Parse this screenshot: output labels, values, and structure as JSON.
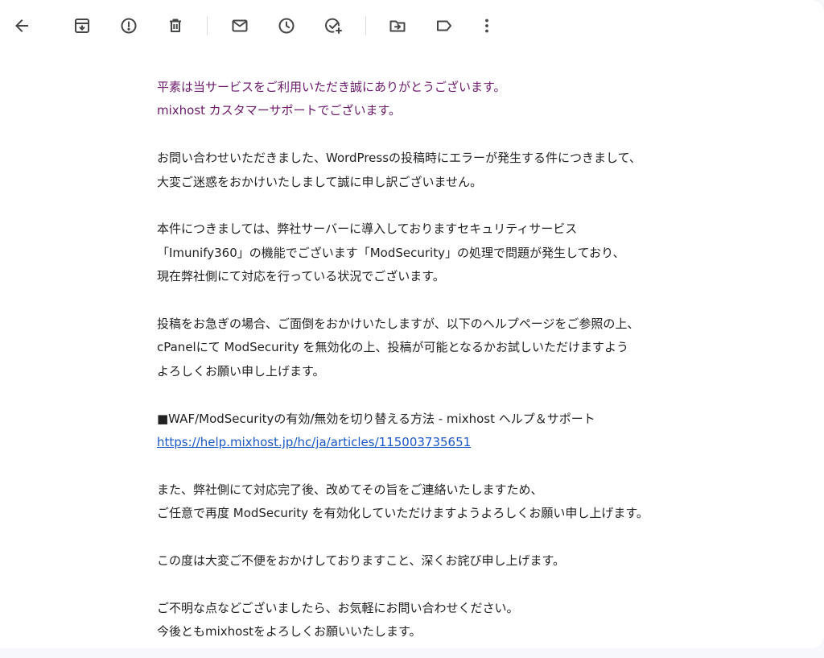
{
  "toolbar": {
    "icons": [
      "back-arrow-icon",
      "archive-icon",
      "report-spam-icon",
      "delete-icon",
      "mark-unread-icon",
      "snooze-icon",
      "add-to-tasks-icon",
      "move-to-icon",
      "label-icon",
      "more-options-icon"
    ]
  },
  "email": {
    "greeting": [
      "平素は当サービスをご利用いただき誠にありがとうございます。",
      "mixhost カスタマーサポートでございます。"
    ],
    "paragraph1": [
      "お問い合わせいただきました、WordPressの投稿時にエラーが発生する件につきまして、",
      "大変ご迷惑をおかけいたしまして誠に申し訳ございません。"
    ],
    "paragraph2": [
      "本件につきましては、弊社サーバーに導入しておりますセキュリティサービス",
      "「Imunify360」の機能でございます「ModSecurity」の処理で問題が発生しており、",
      "現在弊社側にて対応を行っている状況でございます。"
    ],
    "paragraph3": [
      "投稿をお急ぎの場合、ご面倒をおかけいたしますが、以下のヘルプページをご参照の上、",
      "cPanelにて ModSecurity を無効化の上、投稿が可能となるかお試しいただけますよう",
      "よろしくお願い申し上げます。"
    ],
    "help_title": "■WAF/ModSecurityの有効/無効を切り替える方法 - mixhost ヘルプ＆サポート",
    "help_link": "https://help.mixhost.jp/hc/ja/articles/115003735651",
    "paragraph4": [
      "また、弊社側にて対応完了後、改めてその旨をご連絡いたしますため、",
      "ご任意で再度 ModSecurity を有効化していただけますようよろしくお願い申し上げます。"
    ],
    "paragraph5": "この度は大変ご不便をおかけしておりますこと、深くお詫び申し上げます。",
    "closing": [
      "ご不明な点などございましたら、お気軽にお問い合わせください。",
      "今後ともmixhostをよろしくお願いいたします。"
    ]
  },
  "colors": {
    "greeting_text": "#6a1b6a",
    "body_text": "#222222",
    "link": "#1a57c7",
    "icon": "#444746"
  }
}
